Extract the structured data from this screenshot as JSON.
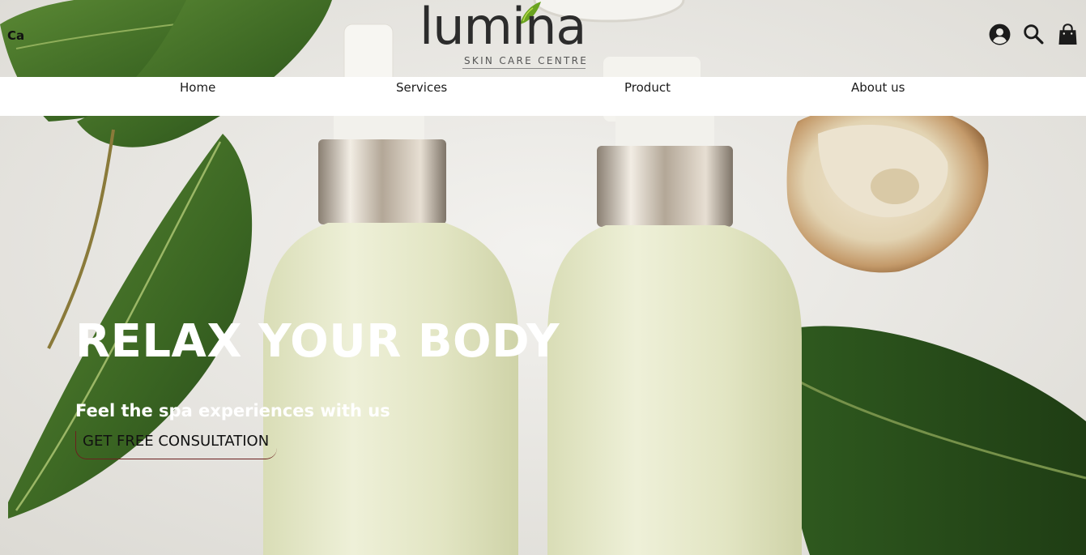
{
  "header": {
    "lang_label": "Ca",
    "logo": {
      "word": "lumina",
      "tagline": "SKIN CARE CENTRE"
    },
    "icons": [
      "user-circle-icon",
      "search-icon",
      "shopping-bag-icon"
    ]
  },
  "nav": {
    "items": [
      {
        "label": "Home"
      },
      {
        "label": "Services"
      },
      {
        "label": "Product"
      },
      {
        "label": "About us"
      }
    ]
  },
  "hero": {
    "title": "RELAX YOUR BODY",
    "subtitle": "Feel the spa experiences with us",
    "cta_label": "GET FREE CONSULTATION"
  },
  "colors": {
    "nav_bg": "#ffffff",
    "hero_text": "#ffffff",
    "leaf_green": "#3f6b26",
    "bottle": "#dfe3c0",
    "cta_border": "#6b1f1f"
  }
}
